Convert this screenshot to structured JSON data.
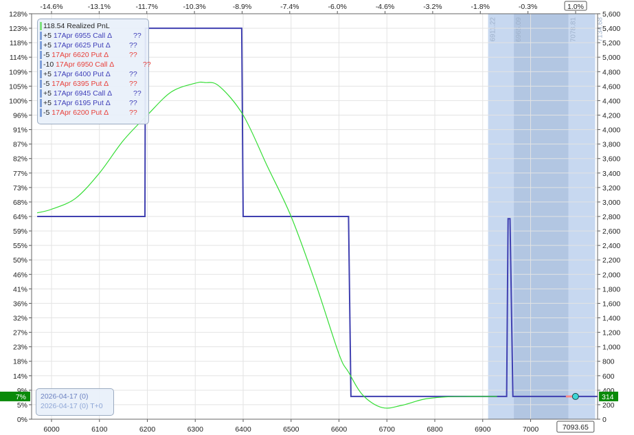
{
  "chart_data": {
    "type": "line",
    "x_ticks": [
      "6000",
      "6100",
      "6200",
      "6300",
      "6400",
      "6500",
      "6600",
      "6700",
      "6800",
      "6900",
      "7000"
    ],
    "top_ticks": [
      "-14.6%",
      "-13.1%",
      "-11.7%",
      "-10.3%",
      "-8.9%",
      "-7.4%",
      "-6.0%",
      "-4.6%",
      "-3.2%",
      "-1.8%",
      "-0.3%",
      "1.0%"
    ],
    "left_ticks": [
      "128%",
      "123%",
      "118%",
      "114%",
      "109%",
      "105%",
      "100%",
      "96%",
      "91%",
      "87%",
      "82%",
      "77%",
      "73%",
      "68%",
      "64%",
      "59%",
      "55%",
      "50%",
      "46%",
      "41%",
      "36%",
      "32%",
      "27%",
      "23%",
      "18%",
      "14%",
      "9%",
      "5%",
      "0%"
    ],
    "right_ticks": [
      "5,600",
      "5,400",
      "5,200",
      "5,000",
      "4,800",
      "4,600",
      "4,400",
      "4,200",
      "4,000",
      "3,800",
      "3,600",
      "3,400",
      "3,200",
      "3,000",
      "2,800",
      "2,600",
      "2,400",
      "2,200",
      "2,000",
      "1,800",
      "1,600",
      "1,400",
      "1,200",
      "1,000",
      "800",
      "600",
      "400",
      "200",
      "0"
    ],
    "xlim": [
      5970,
      7140
    ],
    "ylim_right": [
      0,
      5600
    ],
    "current_price": "7093.65",
    "current_top_pct": "1.0%",
    "current_left_pct": "7%",
    "current_right_value": "314",
    "band_labels": [
      "6911.22",
      "6965.09",
      "7078.81",
      "7134.68"
    ],
    "band_edges": [
      6911.22,
      6965.09,
      7078.81,
      7134.68
    ],
    "series": [
      {
        "color": "#3f3fb0",
        "x": [
          5970,
          6195,
          6196,
          6397,
          6400,
          6620,
          6625,
          6950,
          6953,
          6957,
          6963,
          7140
        ],
        "y": [
          2800,
          2800,
          5400,
          5400,
          2800,
          2800,
          314,
          314,
          2770,
          2770,
          314,
          314
        ]
      },
      {
        "color": "#33dd33",
        "x": [
          5970,
          6000,
          6050,
          6100,
          6150,
          6200,
          6250,
          6300,
          6320,
          6350,
          6400,
          6450,
          6500,
          6550,
          6600,
          6620,
          6650,
          6690,
          6730,
          6780,
          6830,
          6870,
          6900,
          6930
        ],
        "y": [
          2850,
          2900,
          3050,
          3400,
          3850,
          4200,
          4520,
          4640,
          4650,
          4600,
          4200,
          3500,
          2800,
          1900,
          900,
          650,
          330,
          160,
          190,
          280,
          310,
          314,
          314,
          314
        ]
      }
    ]
  },
  "legend": {
    "title": "118.54 Realized PnL",
    "rows": [
      {
        "qty": "+5",
        "desc": "17Apr 6955 Call Δ",
        "q": "??",
        "color": "blue"
      },
      {
        "qty": "+5",
        "desc": "17Apr 6625 Put Δ",
        "q": "??",
        "color": "blue"
      },
      {
        "qty": "-5",
        "desc": "17Apr 6620 Put Δ",
        "q": "??",
        "color": "red"
      },
      {
        "qty": "-10",
        "desc": "17Apr 6950 Call Δ",
        "q": "??",
        "color": "red"
      },
      {
        "qty": "+5",
        "desc": "17Apr 6400 Put Δ",
        "q": "??",
        "color": "blue"
      },
      {
        "qty": "-5",
        "desc": "17Apr 6395 Put Δ",
        "q": "??",
        "color": "red"
      },
      {
        "qty": "+5",
        "desc": "17Apr 6945 Call Δ",
        "q": "??",
        "color": "blue"
      },
      {
        "qty": "+5",
        "desc": "17Apr 6195 Put Δ",
        "q": "??",
        "color": "blue"
      },
      {
        "qty": "-5",
        "desc": "17Apr 6200 Put Δ",
        "q": "??",
        "color": "red"
      }
    ]
  },
  "dates": {
    "line1": "2026-04-17 (0)",
    "line2": "2026-04-17 (0) T+0"
  }
}
